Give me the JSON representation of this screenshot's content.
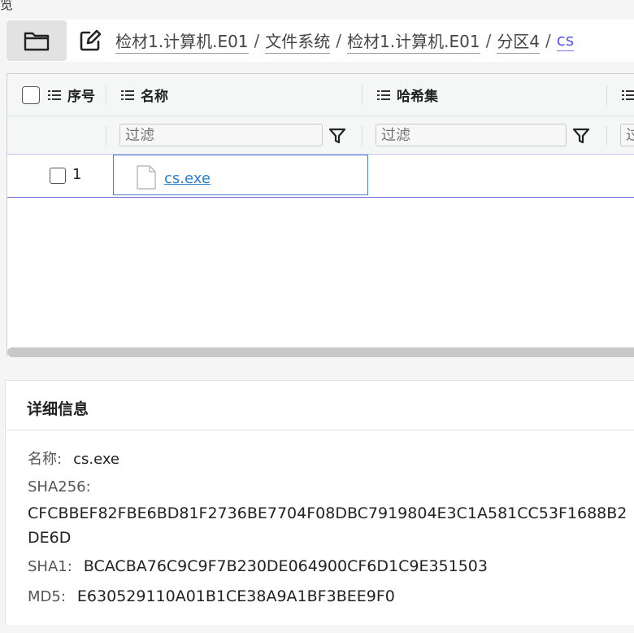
{
  "top_cut_text": "览",
  "breadcrumb": {
    "items": [
      "检材1.计算机.E01",
      "文件系统",
      "检材1.计算机.E01",
      "分区4",
      "cs"
    ],
    "separator": "/"
  },
  "table": {
    "columns": [
      "序号",
      "名称",
      "哈希集"
    ],
    "filter_placeholder": "过滤",
    "rows": [
      {
        "index": "1",
        "name": "cs.exe"
      }
    ]
  },
  "details": {
    "title": "详细信息",
    "name_label": "名称:",
    "name_value": "cs.exe",
    "sha256_label": "SHA256:",
    "sha256_value": "CFCBBEF82FBE6BD81F2736BE7704F08DBC7919804E3C1A581CC53F1688B2DE6D",
    "sha1_label": "SHA1:",
    "sha1_value": "BCACBA76C9C9F7B230DE064900CF6D1C9E351503",
    "md5_label": "MD5:",
    "md5_value": "E630529110A01B1CE38A9A1BF3BEE9F0"
  },
  "colors": {
    "accent": "#5a5af0",
    "link": "#2a7fcf",
    "selection_border": "#4f7fd0"
  },
  "icons": [
    "folder-icon",
    "edit-icon",
    "list-icon",
    "filter-icon",
    "file-icon"
  ]
}
